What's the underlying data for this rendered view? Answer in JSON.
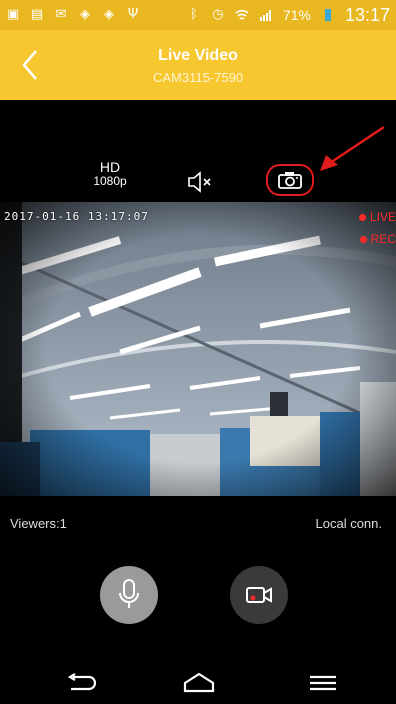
{
  "status_bar": {
    "battery_percent": "71%",
    "time": "13:17",
    "accent": "#e9b820"
  },
  "header": {
    "title": "Live Video",
    "subtitle": "CAM3115-7590",
    "color": "#f7c730"
  },
  "controls": {
    "quality_label": "HD",
    "resolution_label": "1080p",
    "mute_icon": "speaker-muted-icon",
    "snapshot_icon": "camera-icon",
    "highlight_color": "#e01b1b"
  },
  "video": {
    "timestamp": "2017-01-16 13:17:07",
    "live_label": "LIVE",
    "rec_label": "REC",
    "badge_color": "#ff2a2a"
  },
  "info": {
    "viewers": "Viewers:1",
    "connection": "Local conn."
  },
  "actions": {
    "mic_icon": "microphone-icon",
    "record_icon": "video-record-icon"
  },
  "nav": {
    "back_icon": "back-icon",
    "home_icon": "home-icon",
    "menu_icon": "menu-icon"
  }
}
